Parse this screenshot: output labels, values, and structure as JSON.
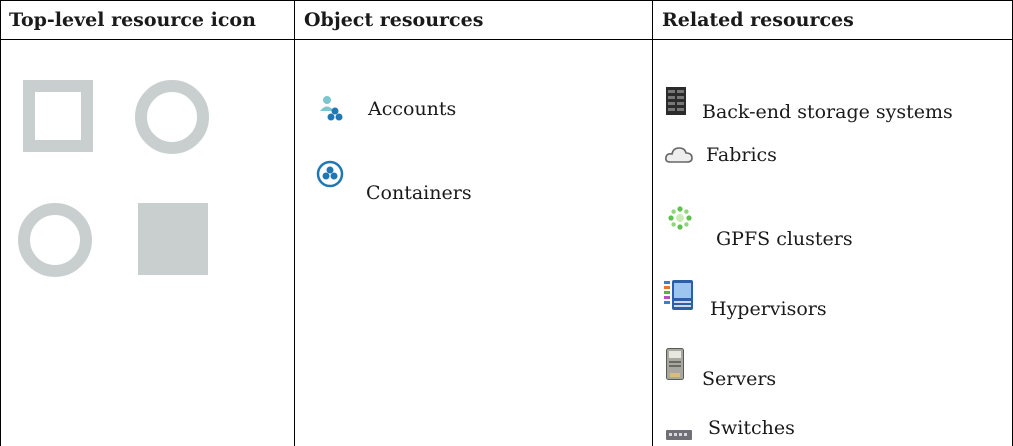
{
  "table": {
    "headers": [
      "Top-level resource icon",
      "Object resources",
      "Related resources"
    ],
    "object_resources": [
      {
        "label": "Accounts",
        "icon": "accounts-icon"
      },
      {
        "label": "Containers",
        "icon": "containers-icon"
      }
    ],
    "related_resources": [
      {
        "label": "Back-end storage systems",
        "icon": "storage-system-icon"
      },
      {
        "label": "Fabrics",
        "icon": "fabric-cloud-icon"
      },
      {
        "label": "GPFS clusters",
        "icon": "gpfs-cluster-icon"
      },
      {
        "label": "Hypervisors",
        "icon": "hypervisor-icon"
      },
      {
        "label": "Servers",
        "icon": "server-icon"
      },
      {
        "label": "Switches",
        "icon": "switch-icon"
      }
    ],
    "top_level_icon": [
      "square-outline",
      "circle-outline",
      "circle-outline",
      "square-filled"
    ],
    "colors": {
      "placeholder_gray": "#c9cfcf",
      "accent_blue": "#1f78b4",
      "border": "#000000"
    }
  }
}
